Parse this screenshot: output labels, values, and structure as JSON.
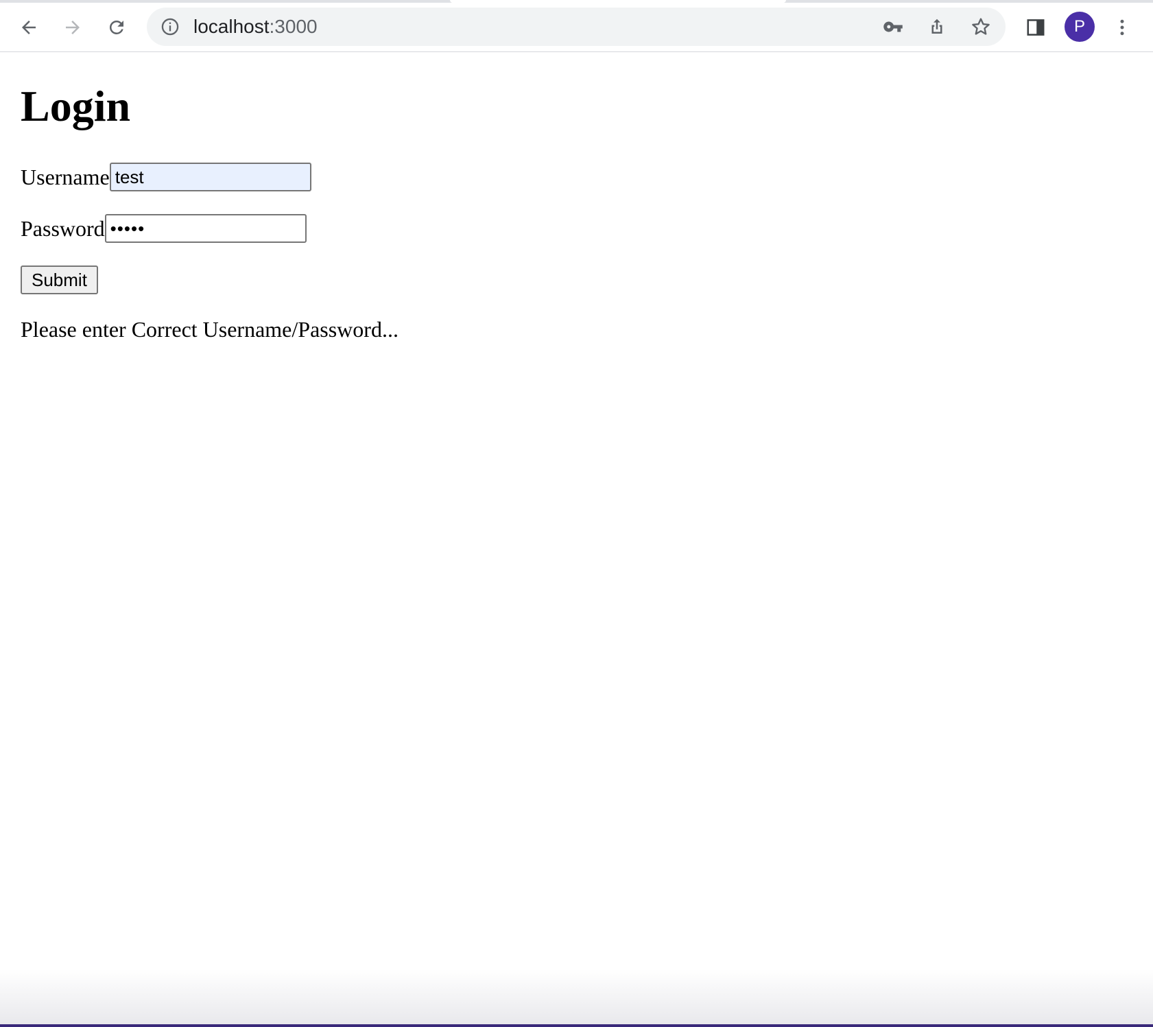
{
  "browser": {
    "url_host": "localhost",
    "url_port": ":3000",
    "profile_initial": "P",
    "icons": {
      "back": "back-arrow-icon",
      "forward": "forward-arrow-icon",
      "reload": "reload-icon",
      "info": "info-icon",
      "key": "key-icon",
      "share": "share-icon",
      "bookmark": "star-icon",
      "sidepanel": "side-panel-icon",
      "menu": "kebab-menu-icon"
    },
    "colors": {
      "avatar": "#4a2fa7",
      "omnibox": "#f1f3f4",
      "autofill": "#e8f0fe"
    }
  },
  "page": {
    "title": "Login",
    "username_label": "Username",
    "username_value": "test",
    "password_label": "Password",
    "password_value": "•••••",
    "submit_label": "Submit",
    "message": "Please enter Correct Username/Password..."
  }
}
